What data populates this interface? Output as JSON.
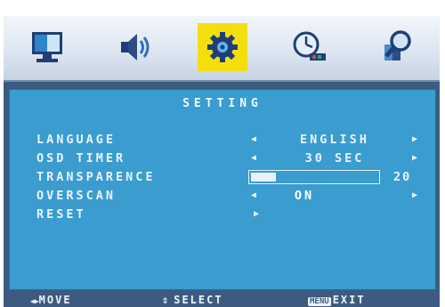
{
  "tabs": [
    {
      "name": "picture",
      "icon": "monitor-icon"
    },
    {
      "name": "audio",
      "icon": "speaker-icon"
    },
    {
      "name": "setting",
      "icon": "gear-icon",
      "selected": true
    },
    {
      "name": "time",
      "icon": "clock-icon"
    },
    {
      "name": "info",
      "icon": "magnifier-icon"
    }
  ],
  "panel": {
    "title": "SETTING",
    "rows": [
      {
        "label": "LANGUAGE",
        "value": "ENGLISH"
      },
      {
        "label": "OSD TIMER",
        "value": "30 SEC"
      },
      {
        "label": "TRANSPARENCE",
        "value": "20",
        "level": 0.2
      },
      {
        "label": "OVERSCAN",
        "value": "ON"
      },
      {
        "label": "RESET",
        "value": ""
      }
    ]
  },
  "footer": {
    "move": "MOVE",
    "select": "SELECT",
    "menu_key": "MENU",
    "exit": "EXIT"
  },
  "colors": {
    "panel": "#3a9ccf",
    "frame": "#3d5b80",
    "selected_tab": "#f3df0e"
  }
}
